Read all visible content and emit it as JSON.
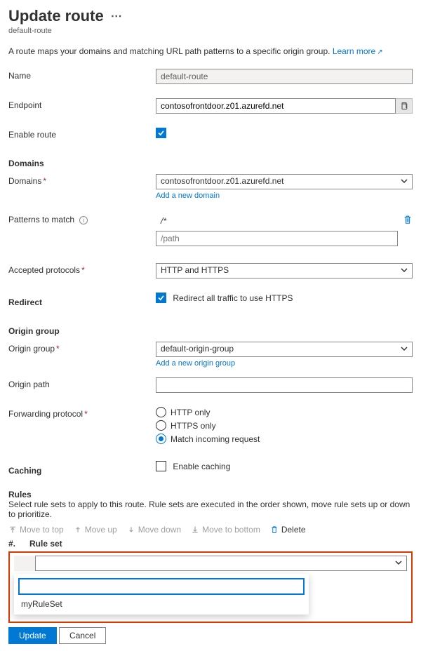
{
  "header": {
    "title": "Update route",
    "subtitle": "default-route",
    "description": "A route maps your domains and matching URL path patterns to a specific origin group.",
    "learn_more": "Learn more"
  },
  "name": {
    "label": "Name",
    "value": "default-route"
  },
  "endpoint": {
    "label": "Endpoint",
    "value": "contosofrontdoor.z01.azurefd.net"
  },
  "enable": {
    "label": "Enable route",
    "checked": true
  },
  "domains": {
    "heading": "Domains",
    "label": "Domains",
    "selected": "contosofrontdoor.z01.azurefd.net",
    "add_link": "Add a new domain"
  },
  "patterns": {
    "label": "Patterns to match",
    "existing": "/*",
    "placeholder": "/path"
  },
  "protocols": {
    "label": "Accepted protocols",
    "value": "HTTP and HTTPS"
  },
  "redirect": {
    "heading": "Redirect",
    "label": "Redirect all traffic to use HTTPS",
    "checked": true
  },
  "origin": {
    "heading": "Origin group",
    "group_label": "Origin group",
    "group_value": "default-origin-group",
    "add_link": "Add a new origin group",
    "path_label": "Origin path",
    "path_value": ""
  },
  "forwarding": {
    "label": "Forwarding protocol",
    "options": {
      "http": "HTTP only",
      "https": "HTTPS only",
      "match": "Match incoming request"
    },
    "selected": "match"
  },
  "caching": {
    "heading": "Caching",
    "label": "Enable caching",
    "checked": false
  },
  "rules": {
    "heading": "Rules",
    "description": "Select rule sets to apply to this route. Rule sets are executed in the order shown, move rule sets up or down to prioritize.",
    "toolbar": {
      "top": "Move to top",
      "up": "Move up",
      "down": "Move down",
      "bottom": "Move to bottom",
      "del": "Delete"
    },
    "col_num": "#.",
    "col_ruleset": "Rule set",
    "filter_value": "",
    "option1": "myRuleSet"
  },
  "buttons": {
    "update": "Update",
    "cancel": "Cancel"
  }
}
